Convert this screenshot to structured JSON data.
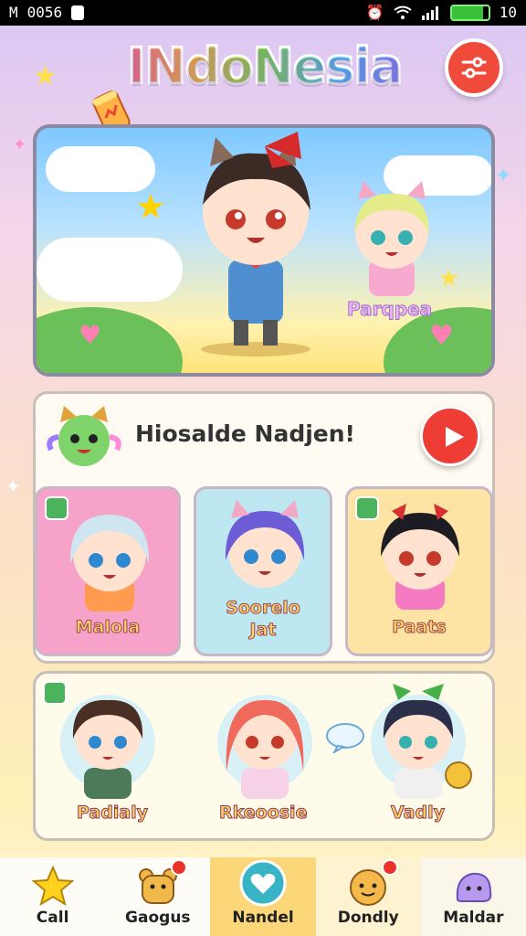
{
  "status_bar": {
    "carrier": "M",
    "time": "0056",
    "right_text": "10"
  },
  "header": {
    "title": "INdoNesia"
  },
  "hero": {
    "character_name": "Parqpea"
  },
  "welcome": {
    "text": "Hiosalde Nadjen!"
  },
  "cards": [
    {
      "label": "Malola",
      "bg": "#f7a2c8"
    },
    {
      "label": "Soorelo\nJat",
      "bg": "#bde8f2"
    },
    {
      "label": "Paats",
      "bg": "#fde3a4"
    }
  ],
  "second_row": [
    {
      "label": "Padialy"
    },
    {
      "label": "Rkeoosie"
    },
    {
      "label": "Vadly"
    }
  ],
  "nav": [
    {
      "label": "Call",
      "icon": "star-icon"
    },
    {
      "label": "Gaogus",
      "icon": "bear-icon"
    },
    {
      "label": "Nandel",
      "icon": "heart-icon"
    },
    {
      "label": "Dondly",
      "icon": "face-icon"
    },
    {
      "label": "Maldar",
      "icon": "blob-icon"
    }
  ],
  "colors": {
    "accent": "#f04a3a",
    "nav_active": "#fcd77a",
    "badge": "#4bb35c"
  }
}
